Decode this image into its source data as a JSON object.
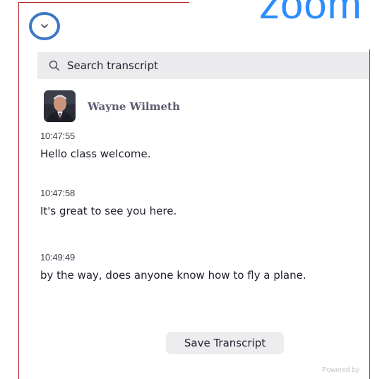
{
  "brand": {
    "logo_text": "zoom",
    "accent_color": "#2d8cff"
  },
  "header": {
    "collapse_icon": "chevron-down-icon",
    "highlight_color": "#3b77c4"
  },
  "search": {
    "placeholder": "Search transcript",
    "icon": "search-icon"
  },
  "speaker": {
    "name": "Wayne Wilmeth",
    "avatar": "speaker-avatar-photo"
  },
  "entries": [
    {
      "time": "10:47:55",
      "text": "Hello class welcome."
    },
    {
      "time": "10:47:58",
      "text": "It's great to see you here."
    },
    {
      "time": "10:49:49",
      "text": "by the way, does anyone know how to fly a plane."
    }
  ],
  "footer": {
    "save_label": "Save Transcript",
    "powered_text": "Powered by"
  }
}
